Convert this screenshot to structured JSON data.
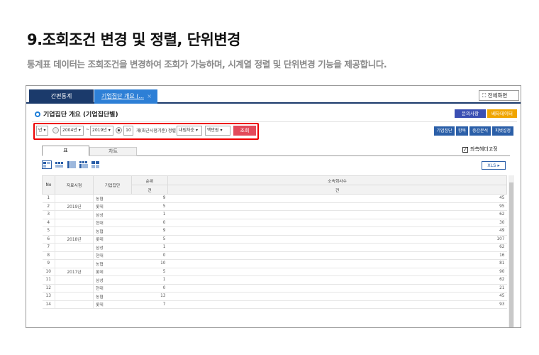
{
  "heading": {
    "title": "9.조회조건 변경 및 정렬, 단위변경",
    "subtitle": "통계표 데이터는 조회조건을 변경하여 조회가 가능하며, 시계열 정렬 및 단위변경 기능을 제공합니다."
  },
  "app": {
    "tabs": {
      "home": "간편통계",
      "active": "기업집단 개요 (...",
      "close": "×"
    },
    "fullscreen_label": "전체화면",
    "section_title": "기업집단 개요 (기업집단별)",
    "inquiry_label": "문의사항",
    "beta_label": "베타데이터",
    "filter": {
      "period_unit": "년",
      "from": "2004년",
      "tilde": "~",
      "to": "2019년",
      "recent_count": "10",
      "recent_label": "개(최근시점기준)",
      "sort_label": "정렬",
      "sort_value": "내림차순",
      "unit_value": "백만원",
      "search_label": "조회"
    },
    "right_buttons": [
      "기업집단",
      "항목",
      "증감분석",
      "피벗설정"
    ],
    "view_tabs": {
      "table": "표",
      "chart": "차트"
    },
    "freeze_label": "좌측헤더고정",
    "xls_label": "XLS ▸",
    "table": {
      "headers": {
        "no": "No",
        "period": "자료시점",
        "group": "기업집단",
        "rank": "순위",
        "rank_unit": "건",
        "affiliates": "소속회사수",
        "affiliates_unit": "건"
      },
      "rows": [
        {
          "no": "1",
          "year": "",
          "group": "농협",
          "rank": "9",
          "count": "45"
        },
        {
          "no": "2",
          "year": "2019년",
          "group": "롯데",
          "rank": "5",
          "count": "95"
        },
        {
          "no": "3",
          "year": "",
          "group": "삼성",
          "rank": "1",
          "count": "62"
        },
        {
          "no": "4",
          "year": "",
          "group": "현대",
          "rank": "0",
          "count": "30"
        },
        {
          "no": "5",
          "year": "",
          "group": "농협",
          "rank": "9",
          "count": "49"
        },
        {
          "no": "6",
          "year": "2018년",
          "group": "롯데",
          "rank": "5",
          "count": "107"
        },
        {
          "no": "7",
          "year": "",
          "group": "삼성",
          "rank": "1",
          "count": "62"
        },
        {
          "no": "8",
          "year": "",
          "group": "현대",
          "rank": "0",
          "count": "16"
        },
        {
          "no": "9",
          "year": "",
          "group": "농협",
          "rank": "10",
          "count": "81"
        },
        {
          "no": "10",
          "year": "2017년",
          "group": "롯데",
          "rank": "5",
          "count": "90"
        },
        {
          "no": "11",
          "year": "",
          "group": "삼성",
          "rank": "1",
          "count": "62"
        },
        {
          "no": "12",
          "year": "",
          "group": "현대",
          "rank": "0",
          "count": "21"
        },
        {
          "no": "13",
          "year": "",
          "group": "농협",
          "rank": "13",
          "count": "45"
        },
        {
          "no": "14",
          "year": "",
          "group": "롯데",
          "rank": "7",
          "count": "93"
        }
      ]
    }
  }
}
